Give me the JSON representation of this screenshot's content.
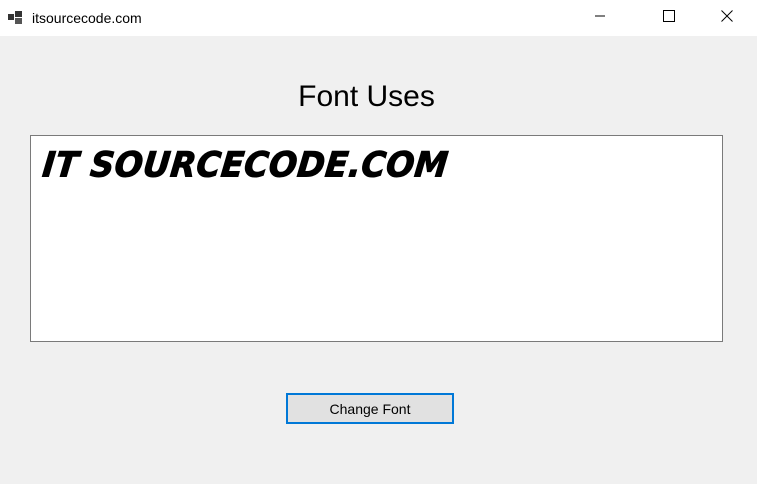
{
  "window": {
    "title": "itsourcecode.com"
  },
  "main": {
    "heading": "Font Uses",
    "textbox_value": "IT SOURCECODE.COM",
    "change_font_label": "Change Font"
  },
  "icons": {
    "app": "app-window-icon",
    "minimize": "minimize-icon",
    "maximize": "maximize-icon",
    "close": "close-icon"
  },
  "colors": {
    "window_bg": "#f0f0f0",
    "titlebar_bg": "#ffffff",
    "accent_border": "#0078d7",
    "button_bg": "#e1e1e1"
  }
}
